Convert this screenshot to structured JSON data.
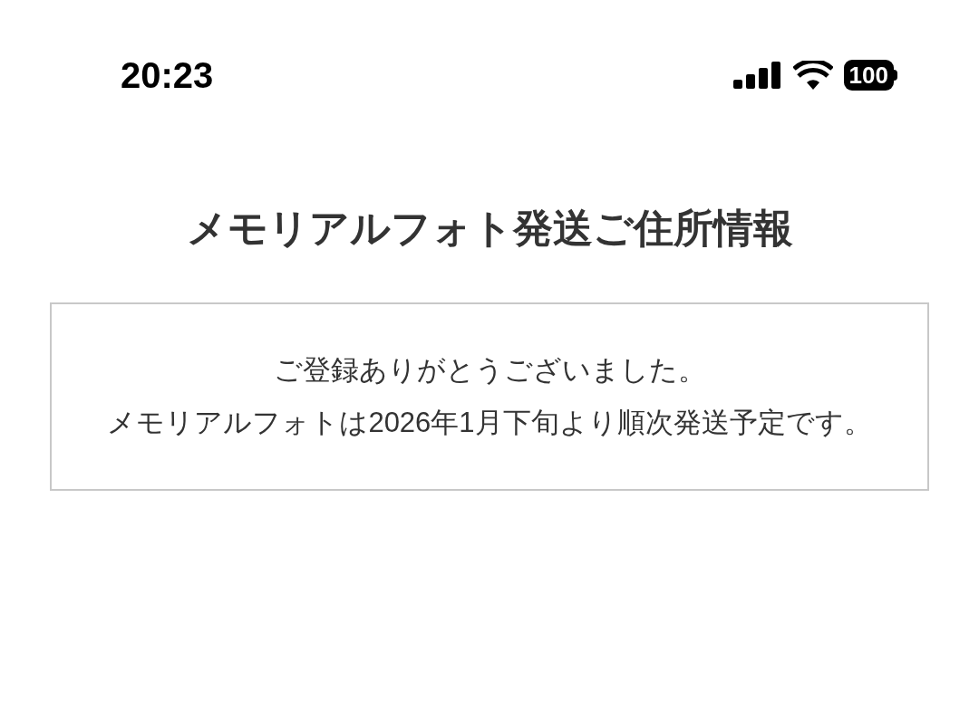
{
  "status_bar": {
    "time": "20:23",
    "battery": "100"
  },
  "title": "メモリアルフォト発送ご住所情報",
  "message": [
    "ご登録ありがとうございました。",
    "メモリアルフォトは2026年1月下旬より順次発送予定です。"
  ]
}
